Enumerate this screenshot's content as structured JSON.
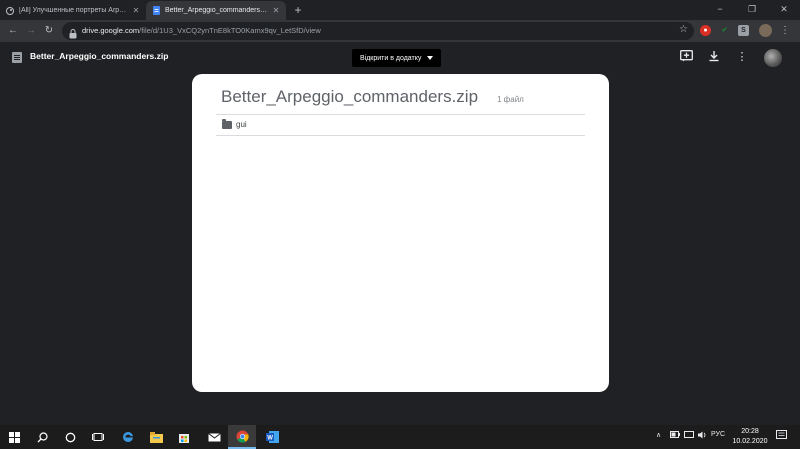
{
  "browser": {
    "tabs": [
      {
        "title": "[All] Улучшенные портреты Arpeggio",
        "favicon": "steam-icon",
        "active": false
      },
      {
        "title": "Better_Arpeggio_commanders.zip",
        "favicon": "google-docs-icon",
        "active": true
      }
    ],
    "new_tab_label": "+",
    "window_controls": {
      "minimize": "−",
      "maximize": "❐",
      "close": "✕"
    },
    "url_host": "drive.google.com",
    "url_path": "/file/d/1U3_VxCQ2ynTnE8kTO0Kamx9qv_LetSfD/view",
    "extension_colors": [
      "#d93025",
      "#188038",
      "#9aa0a6"
    ]
  },
  "drive": {
    "file_name": "Better_Arpeggio_commanders.zip",
    "open_with_label": "Відкрити в додатку",
    "icons": [
      "add-to-drive-icon",
      "download-icon",
      "more-options-icon",
      "account-avatar"
    ]
  },
  "zip_viewer": {
    "title": "Better_Arpeggio_commanders.zip",
    "file_count": "1 файл",
    "entries": [
      {
        "name": "gui",
        "type": "folder"
      }
    ]
  },
  "taskbar": {
    "items": [
      "windows-start-icon",
      "search-icon",
      "cortana-icon",
      "task-view-icon",
      "edge-icon",
      "file-explorer-icon",
      "store-icon",
      "mail-icon",
      "chrome-icon",
      "word-icon"
    ],
    "active_item": "chrome-icon",
    "language": "РУС",
    "time": "20:28",
    "date": "10.02.2020"
  }
}
